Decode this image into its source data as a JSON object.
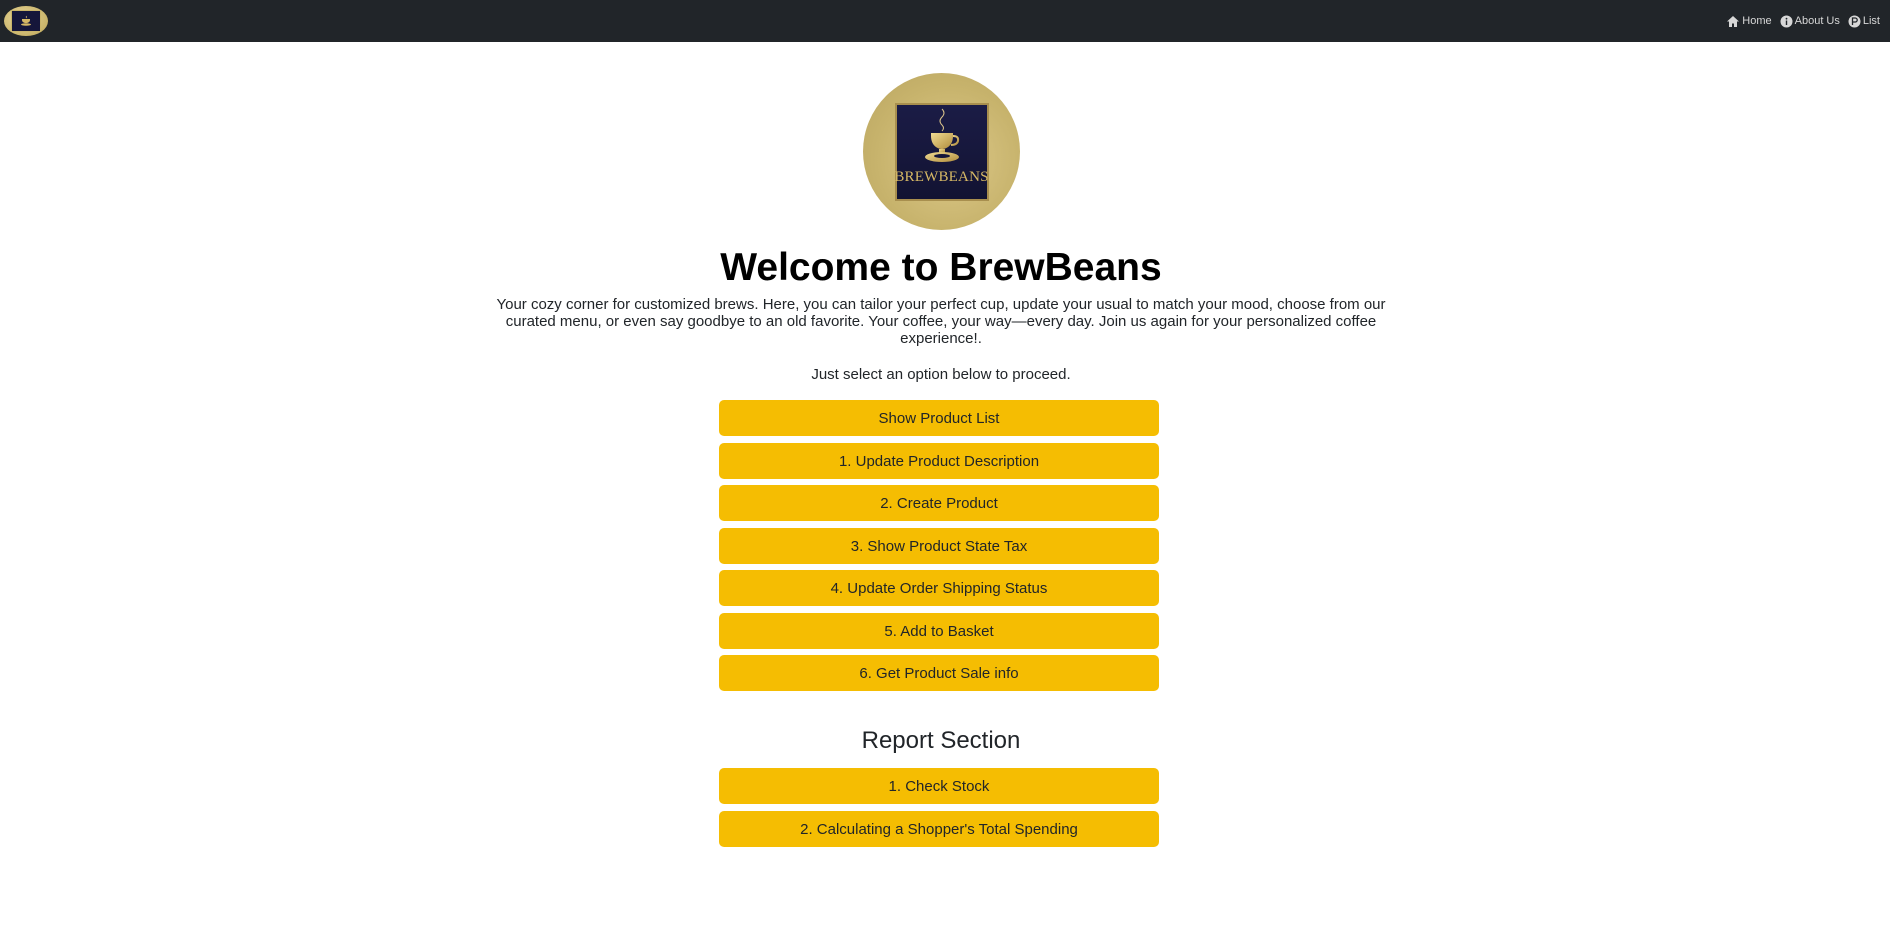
{
  "navbar": {
    "logo_alt": "BrewBeans",
    "links": [
      {
        "label": "Home",
        "icon": "home-icon"
      },
      {
        "label": "About Us",
        "icon": "info-icon"
      },
      {
        "label": "List",
        "icon": "list-icon"
      }
    ]
  },
  "hero": {
    "logo_text": "BREWBEANS",
    "title": "Welcome to BrewBeans",
    "intro": "Your cozy corner for customized brews. Here, you can tailor your perfect cup, update your usual to match your mood, choose from our curated menu, or even say goodbye to an old favorite. Your coffee, your way—every day. Join us again for your personalized coffee experience!.",
    "instruction": "Just select an option below to proceed."
  },
  "actions": [
    "Show Product List",
    "1. Update Product Description",
    "2. Create Product",
    "3. Show Product State Tax",
    "4. Update Order Shipping Status",
    "5. Add to Basket",
    "6. Get Product Sale info"
  ],
  "report": {
    "title": "Report Section",
    "buttons": [
      "1. Check Stock",
      "2. Calculating a Shopper's Total Spending"
    ]
  },
  "colors": {
    "navbar": "#212529",
    "button": "#f5bd02",
    "logo_gold": "#c7b36c",
    "logo_navy": "#15163a"
  }
}
